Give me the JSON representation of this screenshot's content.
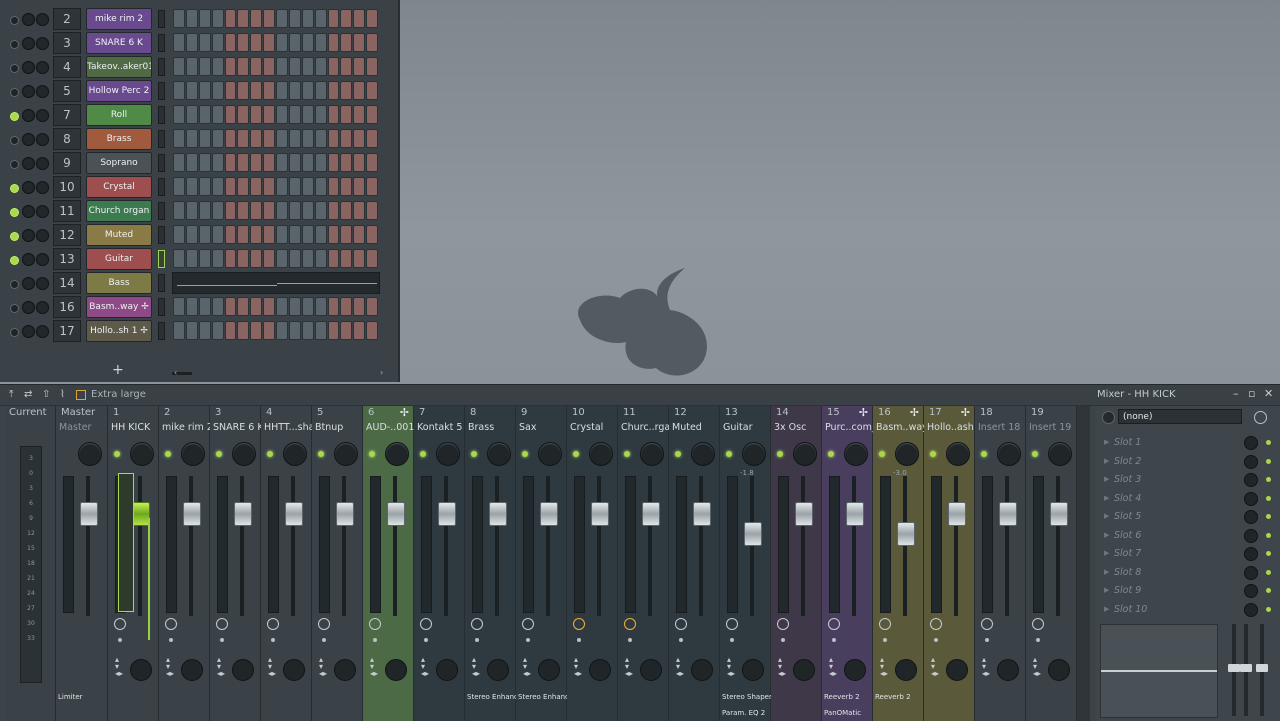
{
  "channel_rack": {
    "rows": [
      {
        "num": "2",
        "name": "mike rim 2",
        "color": "#6a4a8e",
        "led": false,
        "piano": false,
        "active": false
      },
      {
        "num": "3",
        "name": "SNARE 6 K",
        "color": "#6a4a8e",
        "led": false,
        "piano": false,
        "active": false
      },
      {
        "num": "4",
        "name": "Takeov..aker01",
        "color": "#4f6a45",
        "led": false,
        "piano": false,
        "active": false
      },
      {
        "num": "5",
        "name": "Hollow Perc 2",
        "color": "#6a4a8e",
        "led": false,
        "piano": false,
        "active": false
      },
      {
        "num": "7",
        "name": "Roll",
        "color": "#4f8a46",
        "led": true,
        "piano": false,
        "active": false
      },
      {
        "num": "8",
        "name": "Brass",
        "color": "#a05a3e",
        "led": false,
        "piano": false,
        "active": false
      },
      {
        "num": "9",
        "name": "Soprano",
        "color": "#4a5257",
        "led": false,
        "piano": false,
        "active": false
      },
      {
        "num": "10",
        "name": "Crystal",
        "color": "#9e4e4e",
        "led": true,
        "piano": false,
        "active": false
      },
      {
        "num": "11",
        "name": "Church organ",
        "color": "#3d7a4f",
        "led": true,
        "piano": false,
        "active": false
      },
      {
        "num": "12",
        "name": "Muted",
        "color": "#8a7a45",
        "led": true,
        "piano": false,
        "active": false
      },
      {
        "num": "13",
        "name": "Guitar",
        "color": "#9e4e4e",
        "led": true,
        "piano": false,
        "active": true
      },
      {
        "num": "14",
        "name": "Bass",
        "color": "#7e7a45",
        "led": false,
        "piano": true,
        "active": false
      },
      {
        "num": "16",
        "name": "Basm..way ✢",
        "color": "#8e4a86",
        "led": false,
        "piano": false,
        "active": false
      },
      {
        "num": "17",
        "name": "Hollo..sh 1 ✢",
        "color": "#5e5a4a",
        "led": false,
        "piano": false,
        "active": false
      }
    ],
    "add_label": "+"
  },
  "mixer_toolbar": {
    "size_label": "Extra large",
    "title": "Mixer - HH KICK",
    "icons": [
      "pin-icon",
      "mixer-route-icon",
      "upload-icon",
      "wave-icon",
      "layout-icon"
    ]
  },
  "mixer": {
    "strips": [
      {
        "num": "Current",
        "name": "",
        "color": "#3a4247",
        "current": true
      },
      {
        "num": "Master",
        "name": "Master",
        "color": "#3a4247",
        "master": true,
        "fx1": "Limiter",
        "fx2": ""
      },
      {
        "num": "1",
        "name": "HH KICK",
        "color": "#3a4247",
        "selected": true,
        "fx1": "",
        "fx2": ""
      },
      {
        "num": "2",
        "name": "mike rim 2",
        "color": "#3a4247",
        "fx1": "",
        "fx2": ""
      },
      {
        "num": "3",
        "name": "SNARE 6 K",
        "color": "#3a4247",
        "fx1": "",
        "fx2": ""
      },
      {
        "num": "4",
        "name": "HHTT...shak",
        "color": "#3a4247",
        "fx1": "",
        "fx2": ""
      },
      {
        "num": "5",
        "name": "Btnup",
        "color": "#3a4247",
        "fx1": "",
        "fx2": ""
      },
      {
        "num": "6",
        "name": "AUD-..0010",
        "color": "#4c6a45",
        "fx1": "",
        "fx2": "",
        "wave": true
      },
      {
        "num": "7",
        "name": "Kontakt 5",
        "color": "#2f3a40",
        "fx1": "",
        "fx2": ""
      },
      {
        "num": "8",
        "name": "Brass",
        "color": "#2f3a40",
        "fx1": "Stereo Enhancer",
        "fx2": ""
      },
      {
        "num": "9",
        "name": "Sax",
        "color": "#2f3a40",
        "fx1": "Stereo Enhancer",
        "fx2": ""
      },
      {
        "num": "10",
        "name": "Crystal",
        "color": "#2f3a40",
        "fx1": "",
        "fx2": "",
        "orange": true
      },
      {
        "num": "11",
        "name": "Churc..rgan",
        "color": "#2f3a40",
        "fx1": "",
        "fx2": "",
        "orange": true
      },
      {
        "num": "12",
        "name": "Muted",
        "color": "#2f3a40",
        "fx1": "",
        "fx2": ""
      },
      {
        "num": "13",
        "name": "Guitar",
        "color": "#2f3a40",
        "fx1": "Stereo Shaper",
        "fx2": "Param. EQ 2",
        "faderval": "-1.8"
      },
      {
        "num": "14",
        "name": "3x Osc",
        "color": "#3e3848",
        "fx1": "",
        "fx2": ""
      },
      {
        "num": "15",
        "name": "Purc..com_",
        "color": "#4a3e5e",
        "fx1": "Reeverb 2",
        "fx2": "PanOMatic",
        "wave": true
      },
      {
        "num": "16",
        "name": "Basm..way",
        "color": "#5a5a3a",
        "fx1": "Reeverb 2",
        "fx2": "",
        "wave": true,
        "faderval": "-3.0"
      },
      {
        "num": "17",
        "name": "Hollo..ash 1",
        "color": "#5a5a3a",
        "fx1": "",
        "fx2": "",
        "wave": true
      },
      {
        "num": "18",
        "name": "Insert 18",
        "color": "#3a4247",
        "dim": true,
        "fx1": "",
        "fx2": ""
      },
      {
        "num": "19",
        "name": "Insert 19",
        "color": "#3a4247",
        "dim": true,
        "fx1": "",
        "fx2": ""
      }
    ],
    "scale": [
      "3",
      "0",
      "3",
      "6",
      "9",
      "12",
      "15",
      "18",
      "21",
      "24",
      "27",
      "30",
      "33"
    ]
  },
  "insert_panel": {
    "preset": "(none)",
    "slots": [
      "Slot 1",
      "Slot 2",
      "Slot 3",
      "Slot 4",
      "Slot 5",
      "Slot 6",
      "Slot 7",
      "Slot 8",
      "Slot 9",
      "Slot 10"
    ]
  }
}
